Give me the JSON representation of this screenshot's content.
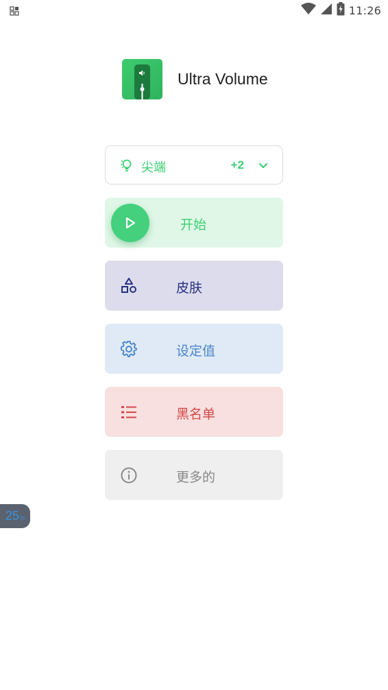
{
  "status_bar": {
    "time": "11:26",
    "left_icon": "notification-grid-icon",
    "icons": [
      "wifi-icon",
      "cell-signal-icon",
      "battery-charging-icon"
    ]
  },
  "app": {
    "title": "Ultra Volume",
    "logo_icon": "volume-slider-logo-icon"
  },
  "mode_select": {
    "label": "尖端",
    "extra_count": "+2",
    "icon": "lightbulb-icon",
    "chevron": "chevron-down-icon"
  },
  "menu": {
    "start": {
      "label": "开始",
      "icon": "play-icon"
    },
    "skin": {
      "label": "皮肤",
      "icon": "shapes-icon"
    },
    "settings": {
      "label": "设定值",
      "icon": "gear-icon"
    },
    "blacklist": {
      "label": "黑名单",
      "icon": "list-icon"
    },
    "more": {
      "label": "更多的",
      "icon": "info-icon"
    }
  },
  "volume_badge": {
    "value": "25",
    "unit": "%"
  },
  "colors": {
    "accent_green": "#3ccf74",
    "skin_navy": "#27307f",
    "settings_blue": "#4a86c8",
    "blacklist_red": "#d44848",
    "more_gray": "#888888"
  }
}
